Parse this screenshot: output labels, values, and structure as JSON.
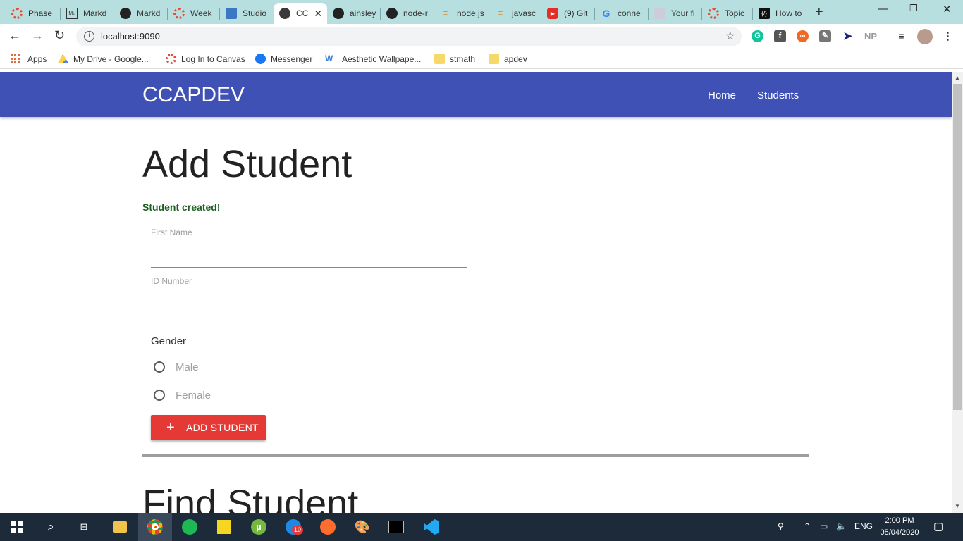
{
  "browser": {
    "tabs": [
      {
        "label": "Phase",
        "icon": "canvas-icon"
      },
      {
        "label": "Markd",
        "icon": "markdown-icon"
      },
      {
        "label": "Markd",
        "icon": "github-icon"
      },
      {
        "label": "Week",
        "icon": "canvas-icon"
      },
      {
        "label": "Studio",
        "icon": "studio-icon"
      },
      {
        "label": "CC",
        "icon": "globe-icon"
      },
      {
        "label": "ainsley",
        "icon": "github-icon"
      },
      {
        "label": "node-r",
        "icon": "github-icon"
      },
      {
        "label": "node.js",
        "icon": "stackoverflow-icon"
      },
      {
        "label": "javasc",
        "icon": "stackoverflow-icon"
      },
      {
        "label": "(9) Git",
        "icon": "youtube-icon"
      },
      {
        "label": "conne",
        "icon": "google-icon"
      },
      {
        "label": "Your fi",
        "icon": "person-icon"
      },
      {
        "label": "Topic",
        "icon": "canvas-icon"
      },
      {
        "label": "How to",
        "icon": "code-icon"
      }
    ],
    "url": "localhost:9090",
    "bookmarks": [
      {
        "label": "Apps"
      },
      {
        "label": "My Drive - Google..."
      },
      {
        "label": "Log In to Canvas"
      },
      {
        "label": "Messenger"
      },
      {
        "label": "Aesthetic Wallpape..."
      },
      {
        "label": "stmath"
      },
      {
        "label": "apdev"
      }
    ],
    "extensions": [
      "NP"
    ]
  },
  "site": {
    "brand": "CCAPDEV",
    "nav": {
      "home": "Home",
      "students": "Students"
    }
  },
  "add_student": {
    "title": "Add Student",
    "message": "Student created!",
    "first_name_label": "First Name",
    "first_name_value": "",
    "id_label": "ID Number",
    "id_value": "",
    "gender_label": "Gender",
    "gender_options": [
      "Male",
      "Female"
    ],
    "submit_label": "ADD STUDENT"
  },
  "find_student": {
    "title": "Find Student"
  },
  "taskbar": {
    "language": "ENG",
    "time": "2:00 PM",
    "date": "05/04/2020",
    "messenger_badge": "10"
  },
  "colors": {
    "navbar": "#3f51b5",
    "button": "#e53935",
    "success": "#1b5e20",
    "focus_line": "#4caf50"
  }
}
